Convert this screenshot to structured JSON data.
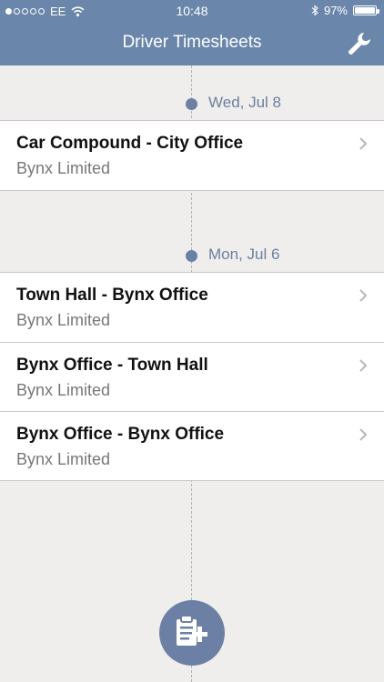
{
  "status_bar": {
    "carrier": "EE",
    "time": "10:48",
    "battery": "97%",
    "signal_bars_filled": 1,
    "signal_bars_total": 5
  },
  "nav": {
    "title": "Driver Timesheets",
    "settings_icon": "wrench-icon"
  },
  "groups": [
    {
      "date": "Wed, Jul 8",
      "entries": [
        {
          "title": "Car Compound - City Office",
          "subtitle": "Bynx Limited"
        }
      ]
    },
    {
      "date": "Mon, Jul 6",
      "entries": [
        {
          "title": "Town Hall - Bynx Office",
          "subtitle": "Bynx Limited"
        },
        {
          "title": "Bynx Office - Town Hall",
          "subtitle": "Bynx Limited"
        },
        {
          "title": "Bynx Office - Bynx Office",
          "subtitle": "Bynx Limited"
        }
      ]
    }
  ],
  "fab": {
    "icon": "add-timesheet-icon"
  },
  "colors": {
    "nav_bar": "#6a87ab",
    "accent": "#6c80a5",
    "background": "#efeeec"
  }
}
